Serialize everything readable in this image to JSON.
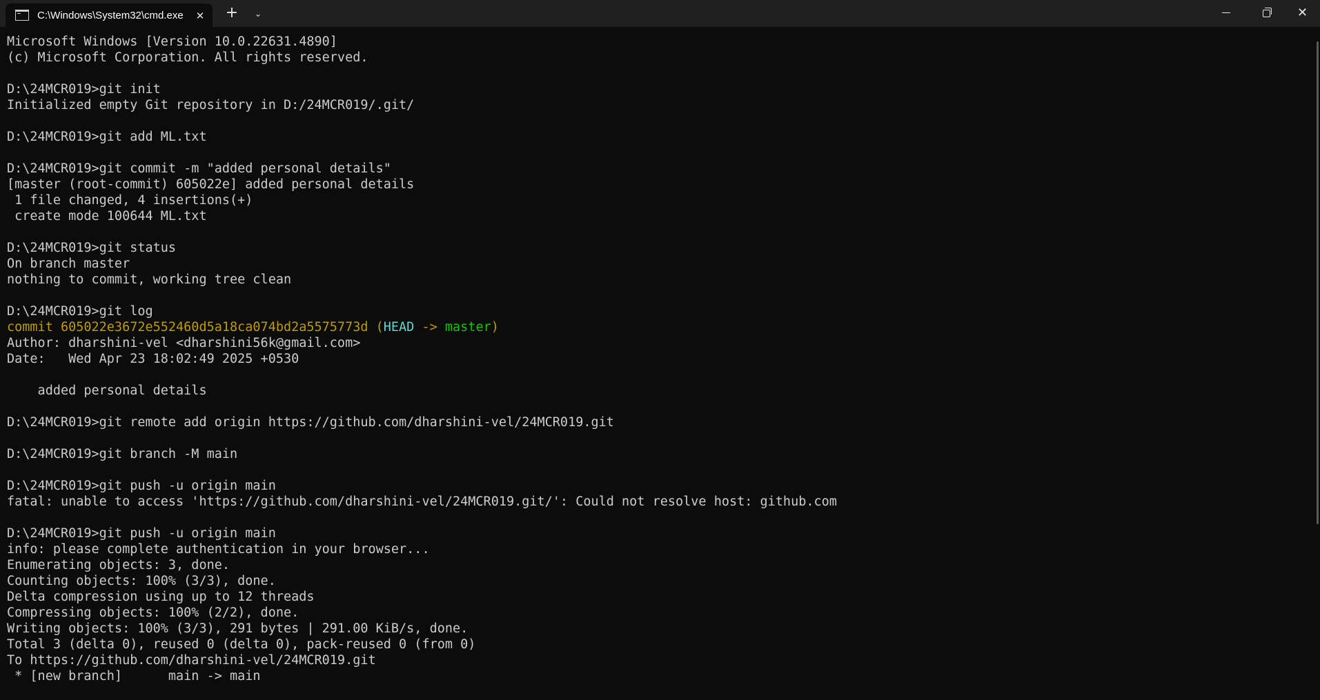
{
  "window": {
    "tab_title": "C:\\Windows\\System32\\cmd.exe",
    "tab_close": "✕",
    "new_tab": "+",
    "dropdown": "⌄",
    "close": "✕",
    "icons": {
      "tab": "terminal-icon",
      "minimize": "minimize-icon",
      "maximize": "restore-icon",
      "close": "close-icon"
    }
  },
  "colors": {
    "background": "#0c0c0c",
    "text": "#cccccc",
    "commit_hash": "#c19c00",
    "head": "#61d6d6",
    "branch": "#16c60c"
  },
  "console": {
    "lines": [
      "Microsoft Windows [Version 10.0.22631.4890]",
      "(c) Microsoft Corporation. All rights reserved.",
      "",
      "D:\\24MCR019>git init",
      "Initialized empty Git repository in D:/24MCR019/.git/",
      "",
      "D:\\24MCR019>git add ML.txt",
      "",
      "D:\\24MCR019>git commit -m \"added personal details\"",
      "[master (root-commit) 605022e] added personal details",
      " 1 file changed, 4 insertions(+)",
      " create mode 100644 ML.txt",
      "",
      "D:\\24MCR019>git status",
      "On branch master",
      "nothing to commit, working tree clean",
      "",
      "D:\\24MCR019>git log"
    ],
    "commit_line": {
      "prefix": "commit 605022e3672e552460d5a18ca074bd2a5575773d (",
      "head": "HEAD",
      "arrow": " -> ",
      "branch": "master",
      "suffix": ")"
    },
    "lines_after": [
      "Author: dharshini-vel <dharshini56k@gmail.com>",
      "Date:   Wed Apr 23 18:02:49 2025 +0530",
      "",
      "    added personal details",
      "",
      "D:\\24MCR019>git remote add origin https://github.com/dharshini-vel/24MCR019.git",
      "",
      "D:\\24MCR019>git branch -M main",
      "",
      "D:\\24MCR019>git push -u origin main",
      "fatal: unable to access 'https://github.com/dharshini-vel/24MCR019.git/': Could not resolve host: github.com",
      "",
      "D:\\24MCR019>git push -u origin main",
      "info: please complete authentication in your browser...",
      "Enumerating objects: 3, done.",
      "Counting objects: 100% (3/3), done.",
      "Delta compression using up to 12 threads",
      "Compressing objects: 100% (2/2), done.",
      "Writing objects: 100% (3/3), 291 bytes | 291.00 KiB/s, done.",
      "Total 3 (delta 0), reused 0 (delta 0), pack-reused 0 (from 0)",
      "To https://github.com/dharshini-vel/24MCR019.git",
      " * [new branch]      main -> main"
    ]
  }
}
